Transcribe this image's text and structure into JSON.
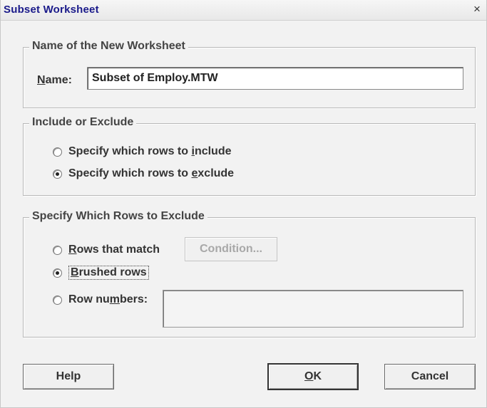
{
  "window": {
    "title": "Subset Worksheet",
    "close_glyph": "×"
  },
  "group_name": {
    "legend": "Name of the New Worksheet",
    "name_label_accel": "N",
    "name_label_rest": "ame:",
    "name_value": "Subset of Employ.MTW"
  },
  "group_include": {
    "legend": "Include or Exclude",
    "options": [
      {
        "pre": "Specify which rows to ",
        "accel": "i",
        "post": "nclude",
        "checked": false
      },
      {
        "pre": "Specify which rows to ",
        "accel": "e",
        "post": "xclude",
        "checked": true
      }
    ]
  },
  "group_rows": {
    "legend": "Specify Which Rows to Exclude",
    "options": [
      {
        "pre": "",
        "accel": "R",
        "post": "ows that match",
        "checked": false
      },
      {
        "pre": "",
        "accel": "B",
        "post": "rushed rows",
        "checked": true
      },
      {
        "pre": "Row nu",
        "accel": "m",
        "post": "bers:",
        "checked": false
      }
    ],
    "condition_button": "Condition..."
  },
  "buttons": {
    "help": "Help",
    "ok_accel": "O",
    "ok_rest": "K",
    "cancel": "Cancel"
  },
  "colors": {
    "title_text": "#1a1a8a",
    "dialog_bg": "#f2f2f2"
  }
}
